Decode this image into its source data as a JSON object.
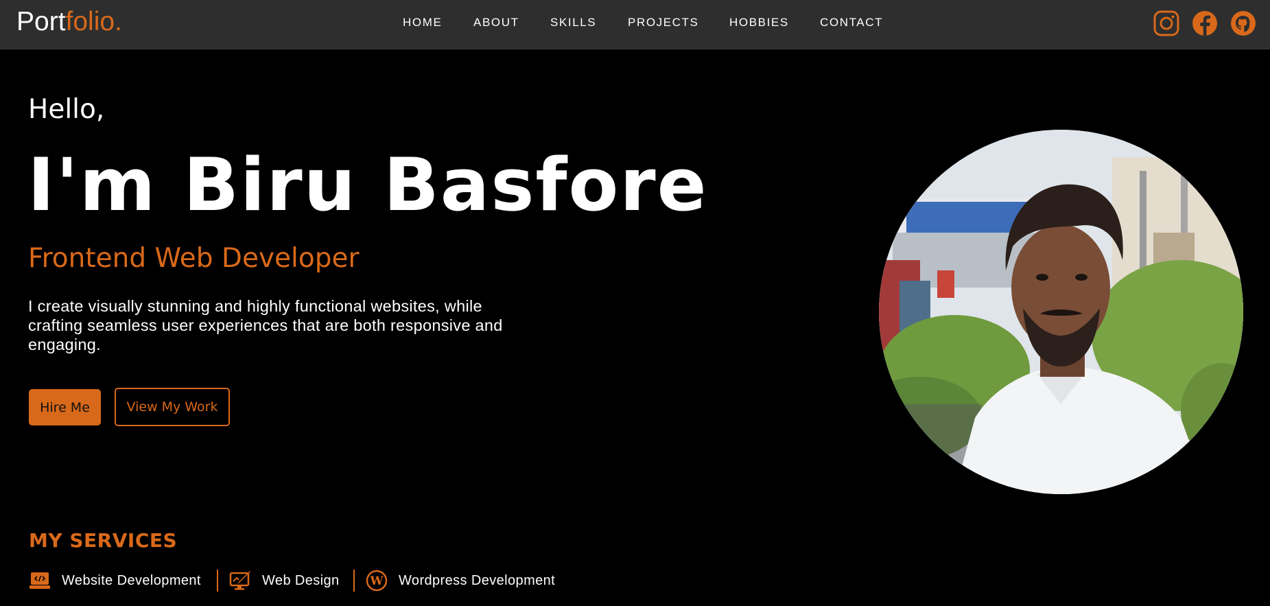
{
  "brand": {
    "logo_part1": "Port",
    "logo_part2": "folio."
  },
  "nav": {
    "items": [
      {
        "label": "HOME"
      },
      {
        "label": "ABOUT"
      },
      {
        "label": "SKILLS"
      },
      {
        "label": "PROJECTS"
      },
      {
        "label": "HOBBIES"
      },
      {
        "label": "CONTACT"
      }
    ],
    "social": [
      "instagram-icon",
      "facebook-icon",
      "github-icon"
    ]
  },
  "hero": {
    "greeting": "Hello,",
    "name": "I'm Biru Basfore",
    "role": "Frontend Web Developer",
    "description": "I create visually stunning and highly functional websites, while crafting seamless user experiences that are both responsive and engaging.",
    "hire_button": "Hire Me",
    "work_button": "View My Work"
  },
  "services": {
    "title": "MY SERVICES",
    "items": [
      {
        "label": "Website Development",
        "icon": "code-laptop-icon"
      },
      {
        "label": "Web Design",
        "icon": "monitor-design-icon"
      },
      {
        "label": "Wordpress Development",
        "icon": "wordpress-icon"
      }
    ]
  },
  "colors": {
    "accent": "#d9691a",
    "navbar": "#2e2e2e",
    "background": "#000000"
  }
}
